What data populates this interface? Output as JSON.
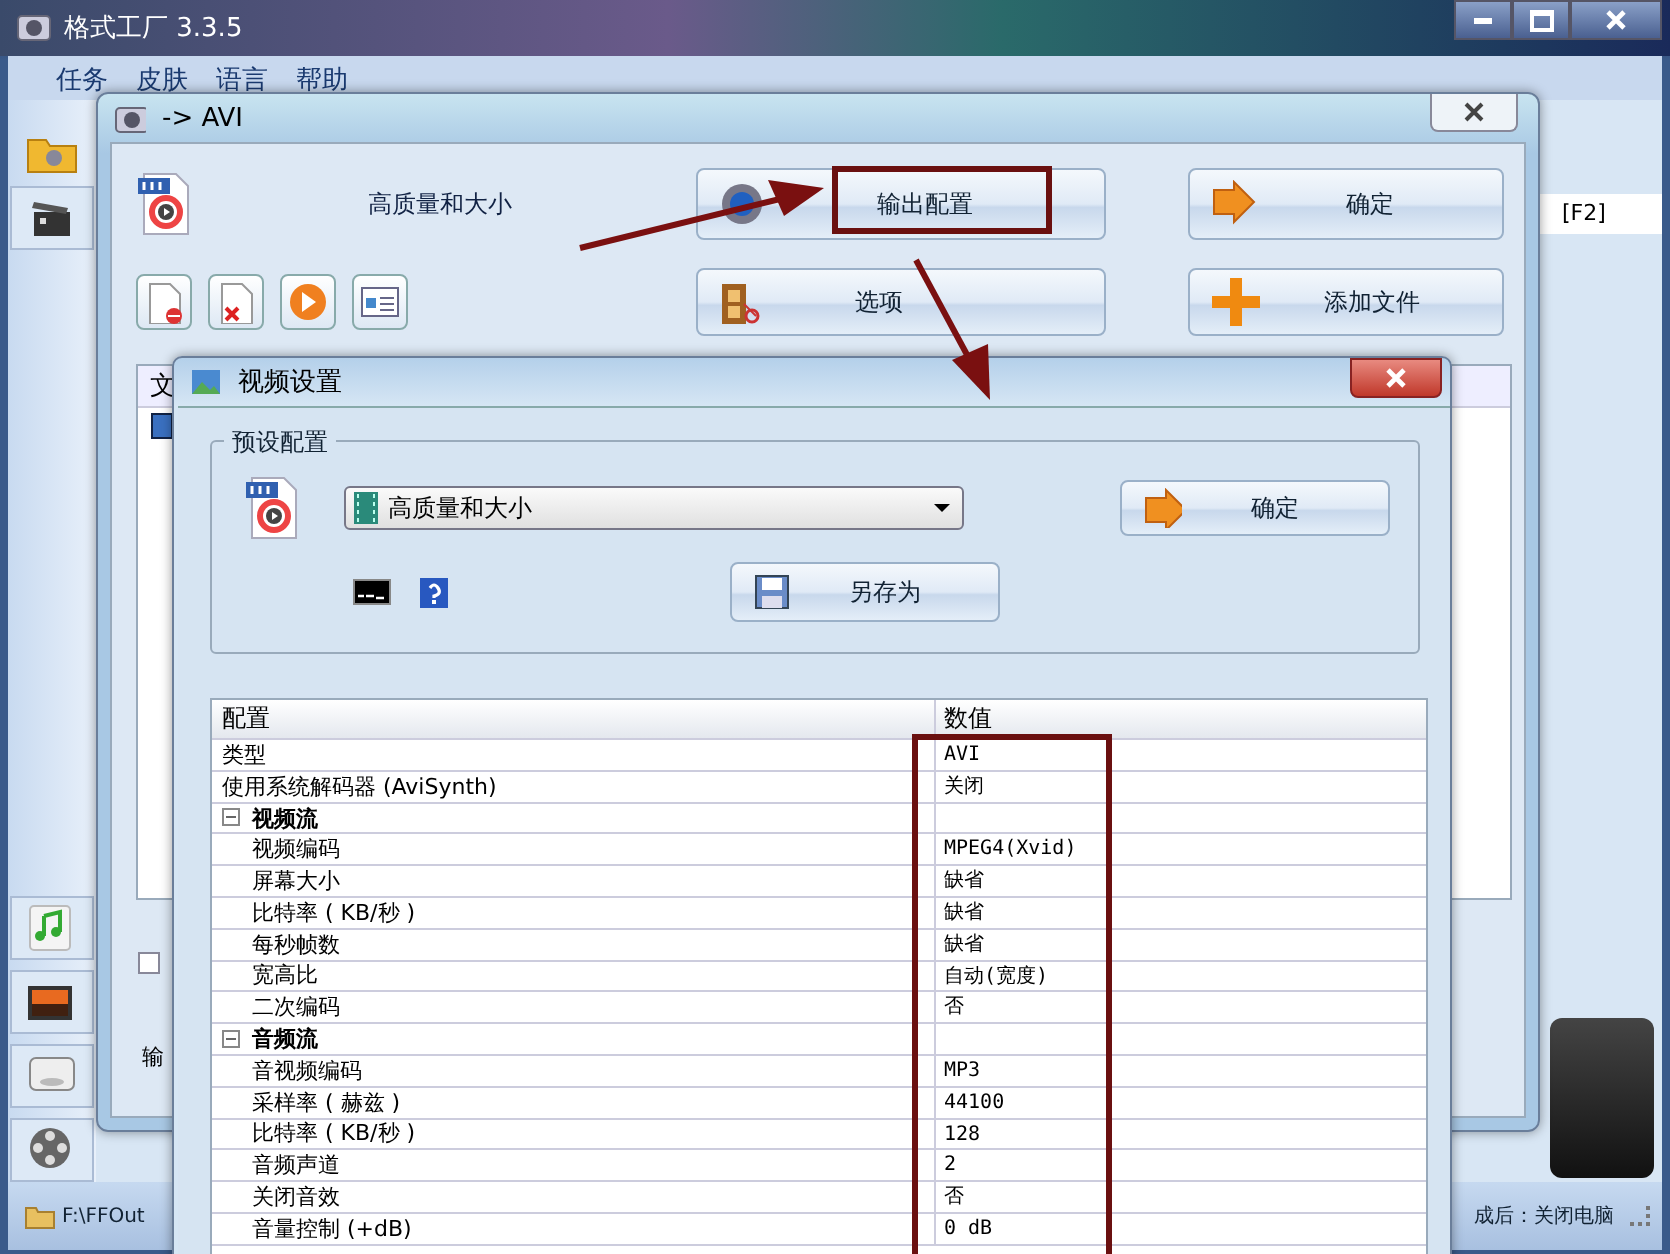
{
  "main_window": {
    "title": "格式工厂 3.3.5",
    "menu": [
      "任务",
      "皮肤",
      "语言",
      "帮助"
    ],
    "side_label": "[F2]",
    "status_left": "F:\\FFOut",
    "status_right": "成后：关闭电脑"
  },
  "convert_dialog": {
    "title": "-> AVI",
    "preset": "高质量和大小",
    "buttons": [
      {
        "kind": "settings",
        "label": "输出配置",
        "highlighted": true
      },
      {
        "kind": "ok",
        "label": "确定",
        "highlighted": false
      },
      {
        "kind": "options",
        "label": "选项",
        "highlighted": false
      },
      {
        "kind": "add",
        "label": "添加文件",
        "highlighted": false
      }
    ],
    "file_list": {
      "column_1": "文"
    },
    "checkbox": {
      "checked": false
    },
    "bottom_label": "输"
  },
  "video_settings": {
    "title": "视频设置",
    "group_title": "预设配置",
    "preset_dropdown": {
      "value": "高质量和大小"
    },
    "ok_button": "确定",
    "save_as_button": "另存为",
    "grid": {
      "columns": [
        "配置",
        "数值"
      ],
      "highlight_values": true,
      "rows": [
        {
          "name": "类型",
          "value": "AVI"
        },
        {
          "name": "使用系统解码器 (AviSynth)",
          "value": "关闭"
        },
        {
          "name": "视频流",
          "expanded": true,
          "children": [
            {
              "name": "视频编码",
              "value": "MPEG4(Xvid)"
            },
            {
              "name": "屏幕大小",
              "value": "缺省"
            },
            {
              "name": "比特率 ( KB/秒 )",
              "value": "缺省"
            },
            {
              "name": "每秒帧数",
              "value": "缺省"
            },
            {
              "name": "宽高比",
              "value": "自动(宽度)"
            },
            {
              "name": "二次编码",
              "value": "否"
            }
          ]
        },
        {
          "name": "音频流",
          "expanded": true,
          "children": [
            {
              "name": "音视频编码",
              "value": "MP3"
            },
            {
              "name": "采样率 ( 赫兹 )",
              "value": "44100"
            },
            {
              "name": "比特率 ( KB/秒 )",
              "value": "128"
            },
            {
              "name": "音频声道",
              "value": "2"
            },
            {
              "name": "关闭音效",
              "value": "否"
            },
            {
              "name": "音量控制 (+dB)",
              "value": "0 dB"
            }
          ]
        }
      ]
    }
  }
}
